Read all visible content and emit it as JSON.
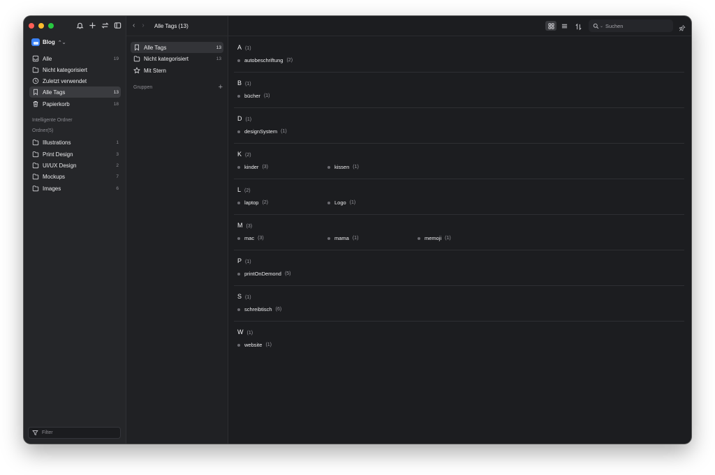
{
  "sidebar": {
    "library": "Blog",
    "items": [
      {
        "label": "Alle",
        "count": "19"
      },
      {
        "label": "Nicht kategorisiert",
        "count": ""
      },
      {
        "label": "Zuletzt verwendet",
        "count": ""
      },
      {
        "label": "Alle Tags",
        "count": "13"
      },
      {
        "label": "Papierkorb",
        "count": "18"
      }
    ],
    "smart_folders_label": "Intelligente Ordner",
    "folders_label": "Ordner(5)",
    "folders": [
      {
        "label": "Illustrations",
        "count": "1"
      },
      {
        "label": "Print Design",
        "count": "3"
      },
      {
        "label": "UI/UX Design",
        "count": "2"
      },
      {
        "label": "Mockups",
        "count": "7"
      },
      {
        "label": "Images",
        "count": "6"
      }
    ],
    "filter_placeholder": "Filter"
  },
  "middle": {
    "items": [
      {
        "label": "Alle Tags",
        "count": "13"
      },
      {
        "label": "Nicht kategorisiert",
        "count": "13"
      },
      {
        "label": "Mit Stern",
        "count": ""
      }
    ],
    "groups_label": "Gruppen",
    "groups_add": "+"
  },
  "toolbar": {
    "back": "‹",
    "forward": "›",
    "title": "Alle Tags (13)",
    "search_placeholder": "Suchen"
  },
  "tag_groups": [
    {
      "letter": "A",
      "count": "(1)",
      "tags": [
        {
          "name": "autobeschriftung",
          "count": "(2)"
        }
      ]
    },
    {
      "letter": "B",
      "count": "(1)",
      "tags": [
        {
          "name": "bücher",
          "count": "(1)"
        }
      ]
    },
    {
      "letter": "D",
      "count": "(1)",
      "tags": [
        {
          "name": "designSystem",
          "count": "(1)"
        }
      ]
    },
    {
      "letter": "K",
      "count": "(2)",
      "tags": [
        {
          "name": "kinder",
          "count": "(3)"
        },
        {
          "name": "kissen",
          "count": "(1)"
        }
      ]
    },
    {
      "letter": "L",
      "count": "(2)",
      "tags": [
        {
          "name": "laptop",
          "count": "(2)"
        },
        {
          "name": "Logo",
          "count": "(1)"
        }
      ]
    },
    {
      "letter": "M",
      "count": "(3)",
      "tags": [
        {
          "name": "mac",
          "count": "(3)"
        },
        {
          "name": "mama",
          "count": "(1)"
        },
        {
          "name": "memoji",
          "count": "(1)"
        }
      ]
    },
    {
      "letter": "P",
      "count": "(1)",
      "tags": [
        {
          "name": "printOnDemond",
          "count": "(5)"
        }
      ]
    },
    {
      "letter": "S",
      "count": "(1)",
      "tags": [
        {
          "name": "schreibtisch",
          "count": "(6)"
        }
      ]
    },
    {
      "letter": "W",
      "count": "(1)",
      "tags": [
        {
          "name": "website",
          "count": "(1)"
        }
      ]
    }
  ]
}
